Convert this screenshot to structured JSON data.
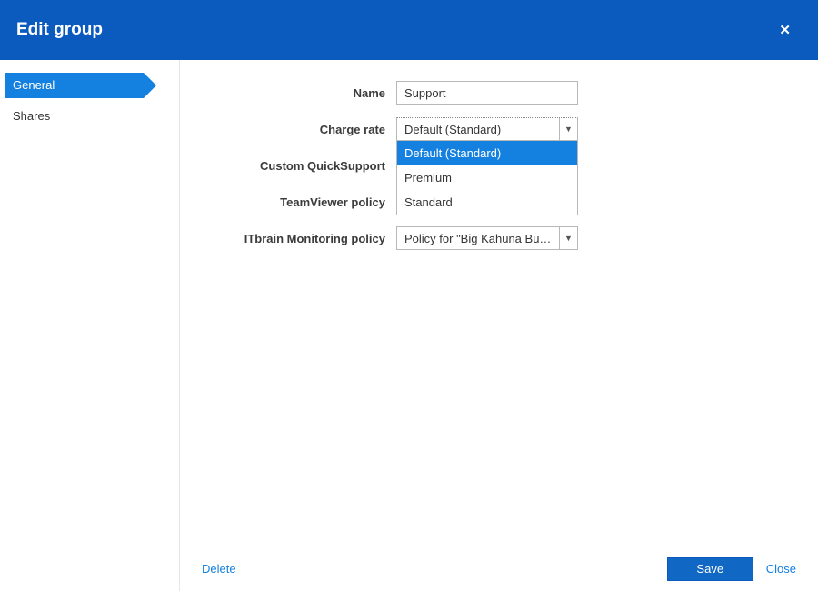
{
  "header": {
    "title": "Edit group",
    "close_icon": "✕"
  },
  "sidebar": {
    "items": [
      {
        "label": "General",
        "active": true
      },
      {
        "label": "Shares",
        "active": false
      }
    ]
  },
  "form": {
    "name_label": "Name",
    "name_value": "Support",
    "charge_rate_label": "Charge rate",
    "charge_rate_value": "Default (Standard)",
    "charge_rate_options": [
      "Default (Standard)",
      "Premium",
      "Standard"
    ],
    "custom_qs_label": "Custom QuickSupport",
    "tv_policy_label": "TeamViewer policy",
    "itbrain_label": "ITbrain Monitoring policy",
    "itbrain_value": "Policy for \"Big Kahuna Bur...",
    "caret": "▼"
  },
  "footer": {
    "delete": "Delete",
    "save": "Save",
    "close": "Close"
  }
}
